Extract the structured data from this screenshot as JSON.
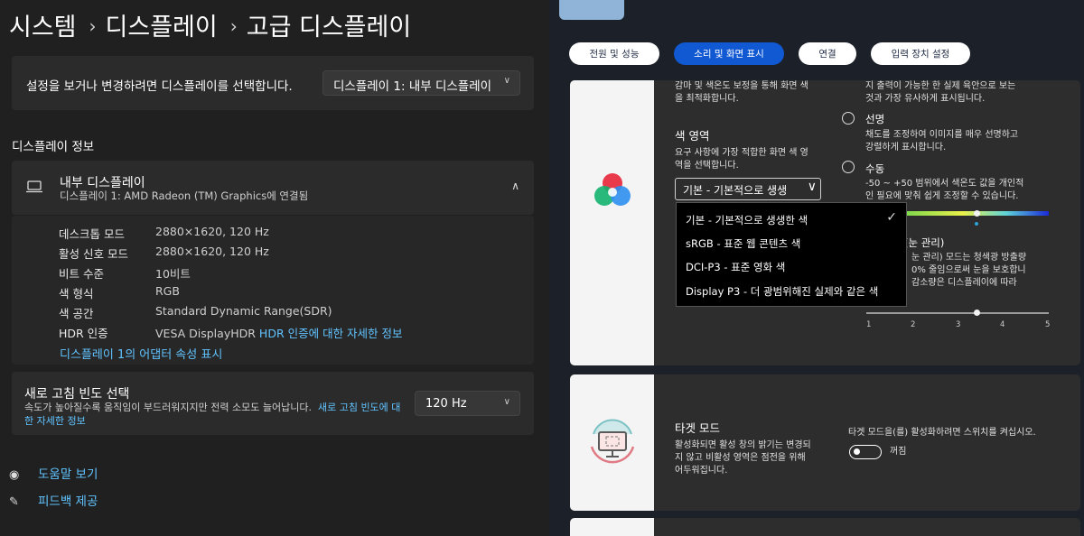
{
  "breadcrumb": {
    "item1": "시스템",
    "sep": "›",
    "item2": "디스플레이",
    "item3": "고급 디스플레이"
  },
  "select_display": {
    "label": "설정을 보거나 변경하려면 디스플레이를 선택합니다.",
    "value": "디스플레이 1: 내부 디스플레이"
  },
  "display_info": {
    "section_title": "디스플레이 정보",
    "header_title": "내부 디스플레이",
    "header_sub": "디스플레이 1: AMD Radeon (TM) Graphics에 연결됨",
    "rows": [
      {
        "label": "데스크톱 모드",
        "value": "2880×1620, 120 Hz"
      },
      {
        "label": "활성 신호 모드",
        "value": "2880×1620, 120 Hz"
      },
      {
        "label": "비트 수준",
        "value": "10비트"
      },
      {
        "label": "색 형식",
        "value": "RGB"
      },
      {
        "label": "색 공간",
        "value": "Standard Dynamic Range(SDR)"
      },
      {
        "label": "HDR 인증",
        "value": "VESA DisplayHDR",
        "link": "HDR 인증에 대한 자세한 정보"
      }
    ],
    "adapter_link": "디스플레이 1의 어댑터 속성 표시"
  },
  "refresh": {
    "title": "새로 고침 빈도 선택",
    "desc": "속도가 높아질수록 움직임이 부드러워지지만 전력 소모도 늘어납니다.",
    "link": "새로 고침 빈도에 대한 자세한 정보",
    "value": "120 Hz"
  },
  "footer": {
    "help": "도움말 보기",
    "feedback": "피드백 제공"
  },
  "tabs": [
    "전원 및 성능",
    "소리 및 화면 표시",
    "연결",
    "입력 장치 설정"
  ],
  "active_tab": 1,
  "color_panel": {
    "top_desc_1": "감마 및 색온도 보정을 통해 화면 색",
    "top_desc_2": "을 최적화합니다.",
    "gamut_title": "색 영역",
    "gamut_desc_1": "요구 사항에 가장 적합한 화면 색 영",
    "gamut_desc_2": "역을 선택합니다.",
    "dropdown_value": "기본 - 기본적으로 생생",
    "options": [
      "기본 - 기본적으로 생생한 색",
      "sRGB - 표준 웹 콘텐츠 색",
      "DCI-P3 - 표준 영화 색",
      "Display P3 - 더 광범위해진 실제와 같은 색"
    ],
    "right_top_1": "지 출력이 가능한 한 실제 육안으로 보는",
    "right_top_2": "것과 가장 유사하게 표시됩니다.",
    "vivid_label": "선명",
    "vivid_desc_1": "채도를 조정하여 이미지를 매우 선명하고",
    "vivid_desc_2": "강렬하게 표시합니다.",
    "manual_label": "수동",
    "manual_desc_1": "-50 ~ +50 범위에서 색온도 값을 개인적",
    "manual_desc_2": "인 필요에 맞춰 쉽게 조정할 수 있습니다.",
    "eye_title": "(눈 관리)",
    "eye_desc_1": "눈 관리) 모드는 청색광 방출량",
    "eye_desc_2": "0% 줄임으로써 눈을 보호합니",
    "eye_desc_3": "감소량은 디스플레이에 따라",
    "scale": [
      "1",
      "2",
      "3",
      "4",
      "5"
    ]
  },
  "target_panel": {
    "title": "타겟 모드",
    "desc_1": "활성화되면 활성 창의 밝기는 변경되",
    "desc_2": "지 않고 비활성 영역은 점전을 위해",
    "desc_3": "어두워집니다.",
    "hint": "타겟 모드을(를) 활성화하려면 스위치를 켜십시오.",
    "toggle_label": "꺼짐"
  }
}
